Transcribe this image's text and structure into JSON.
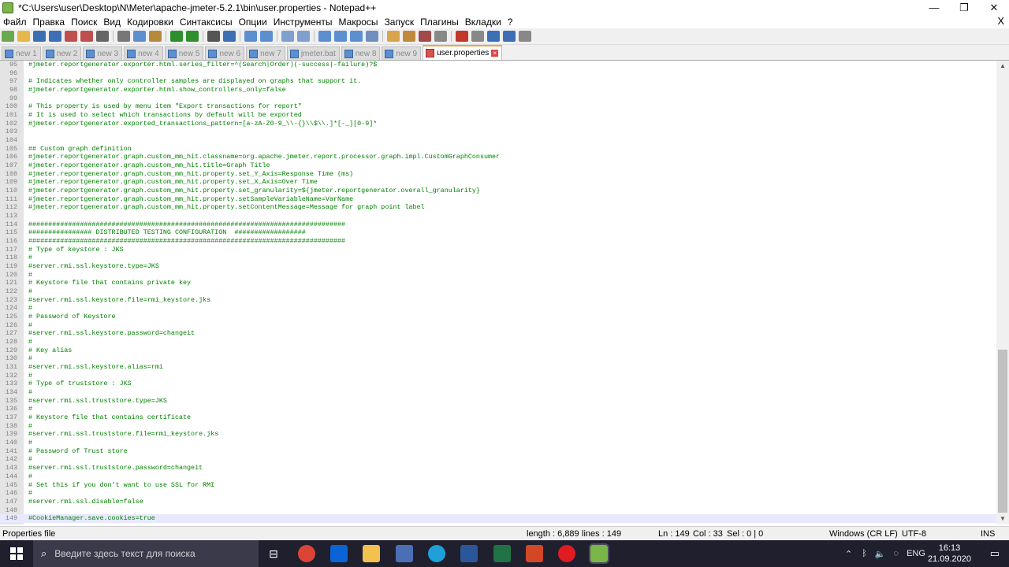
{
  "window": {
    "title": "*C:\\Users\\user\\Desktop\\N\\Meter\\apache-jmeter-5.2.1\\bin\\user.properties - Notepad++",
    "minimize_glyph": "—",
    "maximize_glyph": "❐",
    "close_glyph": "✕"
  },
  "menu": {
    "items": [
      "Файл",
      "Правка",
      "Поиск",
      "Вид",
      "Кодировки",
      "Синтаксисы",
      "Опции",
      "Инструменты",
      "Макросы",
      "Запуск",
      "Плагины",
      "Вкладки",
      "?"
    ],
    "close_glyph": "X"
  },
  "toolbar": {
    "icons": [
      "new-file-icon",
      "open-file-icon",
      "save-icon",
      "save-all-icon",
      "close-file-icon",
      "close-all-icon",
      "print-icon",
      "cut-icon",
      "copy-icon",
      "paste-icon",
      "undo-icon",
      "redo-icon",
      "find-icon",
      "replace-icon",
      "zoom-in-icon",
      "zoom-out-icon",
      "sync-vertical-icon",
      "sync-horizontal-icon",
      "word-wrap-icon",
      "show-all-chars-icon",
      "indent-guide-icon",
      "document-map-icon",
      "function-list-icon",
      "folder-workspace-icon",
      "document-list-icon",
      "monitor-icon",
      "record-macro-icon",
      "stop-macro-icon",
      "play-macro-icon",
      "run-macro-multiple-icon",
      "save-macro-icon"
    ]
  },
  "tabs": [
    {
      "label": "new 1",
      "active": false
    },
    {
      "label": "new 2",
      "active": false
    },
    {
      "label": "new 3",
      "active": false
    },
    {
      "label": "new 4",
      "active": false
    },
    {
      "label": "new 5",
      "active": false
    },
    {
      "label": "new 6",
      "active": false
    },
    {
      "label": "new 7",
      "active": false
    },
    {
      "label": "jmeter.bat",
      "active": false
    },
    {
      "label": "new 8",
      "active": false
    },
    {
      "label": "new 9",
      "active": false
    },
    {
      "label": "user.properties",
      "active": true
    }
  ],
  "editor": {
    "current_line": 149,
    "lines": [
      {
        "n": "95",
        "text": "#jmeter.reportgenerator.exporter.html.series_filter=^(Search|Order)(-success|-failure)?$"
      },
      {
        "n": "96",
        "text": ""
      },
      {
        "n": "97",
        "text": "# Indicates whether only controller samples are displayed on graphs that support it."
      },
      {
        "n": "98",
        "text": "#jmeter.reportgenerator.exporter.html.show_controllers_only=false"
      },
      {
        "n": "99",
        "text": ""
      },
      {
        "n": "100",
        "text": "# This property is used by menu item \"Export transactions for report\""
      },
      {
        "n": "101",
        "text": "# It is used to select which transactions by default will be exported"
      },
      {
        "n": "102",
        "text": "#jmeter.reportgenerator.exported_transactions_pattern=[a-zA-Z0-9_\\\\-{}\\\\$\\\\.]*[-_][0-9]*"
      },
      {
        "n": "103",
        "text": ""
      },
      {
        "n": "104",
        "text": ""
      },
      {
        "n": "105",
        "text": "## Custom graph definition"
      },
      {
        "n": "106",
        "text": "#jmeter.reportgenerator.graph.custom_mm_hit.classname=org.apache.jmeter.report.processor.graph.impl.CustomGraphConsumer"
      },
      {
        "n": "107",
        "text": "#jmeter.reportgenerator.graph.custom_mm_hit.title=Graph Title"
      },
      {
        "n": "108",
        "text": "#jmeter.reportgenerator.graph.custom_mm_hit.property.set_Y_Axis=Response Time (ms)"
      },
      {
        "n": "109",
        "text": "#jmeter.reportgenerator.graph.custom_mm_hit.property.set_X_Axis=Over Time"
      },
      {
        "n": "110",
        "text": "#jmeter.reportgenerator.graph.custom_mm_hit.property.set_granularity=${jmeter.reportgenerator.overall_granularity}"
      },
      {
        "n": "111",
        "text": "#jmeter.reportgenerator.graph.custom_mm_hit.property.setSampleVariableName=VarName"
      },
      {
        "n": "112",
        "text": "#jmeter.reportgenerator.graph.custom_mm_hit.property.setContentMessage=Message for graph point label"
      },
      {
        "n": "113",
        "text": ""
      },
      {
        "n": "114",
        "text": "################################################################################"
      },
      {
        "n": "115",
        "text": "################ DISTRIBUTED TESTING CONFIGURATION  ##################"
      },
      {
        "n": "116",
        "text": "################################################################################"
      },
      {
        "n": "117",
        "text": "# Type of keystore : JKS"
      },
      {
        "n": "118",
        "text": "#"
      },
      {
        "n": "119",
        "text": "#server.rmi.ssl.keystore.type=JKS"
      },
      {
        "n": "120",
        "text": "#"
      },
      {
        "n": "121",
        "text": "# Keystore file that contains private key"
      },
      {
        "n": "122",
        "text": "#"
      },
      {
        "n": "123",
        "text": "#server.rmi.ssl.keystore.file=rmi_keystore.jks"
      },
      {
        "n": "124",
        "text": "#"
      },
      {
        "n": "125",
        "text": "# Password of Keystore"
      },
      {
        "n": "126",
        "text": "#"
      },
      {
        "n": "127",
        "text": "#server.rmi.ssl.keystore.password=changeit"
      },
      {
        "n": "128",
        "text": "#"
      },
      {
        "n": "129",
        "text": "# Key alias"
      },
      {
        "n": "130",
        "text": "#"
      },
      {
        "n": "131",
        "text": "#server.rmi.ssl.keystore.alias=rmi"
      },
      {
        "n": "132",
        "text": "#"
      },
      {
        "n": "133",
        "text": "# Type of truststore : JKS"
      },
      {
        "n": "134",
        "text": "#"
      },
      {
        "n": "135",
        "text": "#server.rmi.ssl.truststore.type=JKS"
      },
      {
        "n": "136",
        "text": "#"
      },
      {
        "n": "137",
        "text": "# Keystore file that contains certificate"
      },
      {
        "n": "138",
        "text": "#"
      },
      {
        "n": "139",
        "text": "#server.rmi.ssl.truststore.file=rmi_keystore.jks"
      },
      {
        "n": "140",
        "text": "#"
      },
      {
        "n": "141",
        "text": "# Password of Trust store"
      },
      {
        "n": "142",
        "text": "#"
      },
      {
        "n": "143",
        "text": "#server.rmi.ssl.truststore.password=changeit"
      },
      {
        "n": "144",
        "text": "#"
      },
      {
        "n": "145",
        "text": "# Set this if you don't want to use SSL for RMI"
      },
      {
        "n": "146",
        "text": "#"
      },
      {
        "n": "147",
        "text": "#server.rmi.ssl.disable=false"
      },
      {
        "n": "148",
        "text": ""
      },
      {
        "n": "149",
        "text": "#CookieManager.save.cookies=true"
      }
    ]
  },
  "status": {
    "file_type": "Properties file",
    "length": "length : 6,889",
    "lines": "lines : 149",
    "ln": "Ln : 149",
    "col": "Col : 33",
    "sel": "Sel : 0 | 0",
    "eol": "Windows (CR LF)",
    "encoding": "UTF-8",
    "mode": "INS"
  },
  "taskbar": {
    "search_placeholder": "Введите здесь текст для поиска",
    "lang": "ENG",
    "time": "16:13",
    "date": "21.09.2020"
  },
  "colors": {
    "comment_green": "#008000",
    "active_tab_accent": "#f4a34a",
    "taskbar_bg": "#1f1f2e"
  }
}
